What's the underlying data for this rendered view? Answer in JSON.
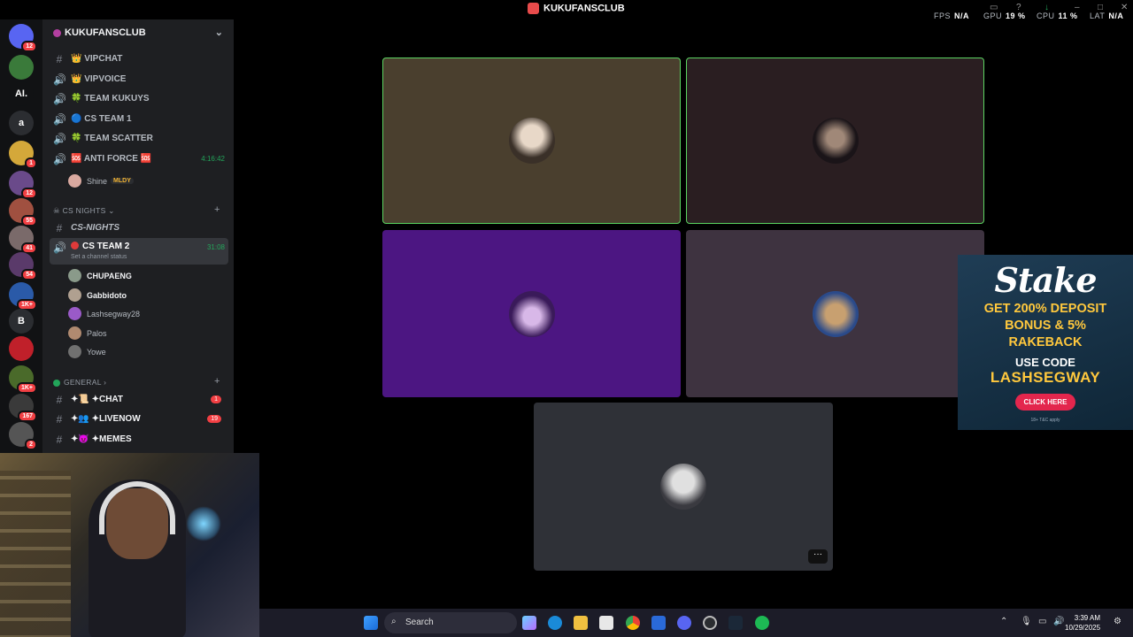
{
  "titlebar": {
    "app_name": "KUKUFANSCLUB",
    "fps_label": "FPS",
    "fps_value": "N/A",
    "gpu_label": "GPU",
    "gpu_value": "19 %",
    "cpu_label": "CPU",
    "cpu_value": "11 %",
    "lat_label": "LAT",
    "lat_value": "N/A"
  },
  "guilds": [
    {
      "label": "",
      "badge": "12",
      "color": "#5865f2"
    },
    {
      "label": "",
      "badge": "",
      "color": "#3a7a3a"
    },
    {
      "label": "AI.",
      "badge": "",
      "color": "#111214"
    },
    {
      "label": "a",
      "badge": "",
      "color": "#2b2d31"
    },
    {
      "label": "",
      "badge": "1",
      "color": "#d4a83a"
    },
    {
      "label": "",
      "badge": "12",
      "color": "#6a4a8a"
    },
    {
      "label": "",
      "badge": "55",
      "color": "#a05040"
    },
    {
      "label": "",
      "badge": "41",
      "color": "#7a6a6a"
    },
    {
      "label": "",
      "badge": "54",
      "color": "#5a3a6a"
    },
    {
      "label": "",
      "badge": "1K+",
      "color": "#2a5aa8"
    },
    {
      "label": "B",
      "badge": "",
      "color": "#2b2d31"
    },
    {
      "label": "",
      "badge": "",
      "color": "#c0202a"
    },
    {
      "label": "",
      "badge": "1K+",
      "color": "#4a6a2a"
    },
    {
      "label": "",
      "badge": "167",
      "color": "#3a3a3a"
    },
    {
      "label": "",
      "badge": "2",
      "color": "#555"
    }
  ],
  "server": {
    "name": "KUKUFANSCLUB",
    "channels_top": [
      {
        "icon": "#",
        "name": "👑 VIPCHAT",
        "timer": ""
      },
      {
        "icon": "🔊",
        "name": "👑 VIPVOICE",
        "timer": ""
      },
      {
        "icon": "🔊",
        "name": "🍀 TEAM KUKUYS",
        "timer": ""
      },
      {
        "icon": "🔊",
        "name": "🔵 CS TEAM 1",
        "timer": ""
      },
      {
        "icon": "🔊",
        "name": "🍀 TEAM SCATTER",
        "timer": ""
      },
      {
        "icon": "🔊",
        "name": "🆘 ANTI FORCE 🆘",
        "timer": "4:16:42"
      }
    ],
    "anti_force_user": {
      "name": "Shine",
      "tag": "MLDY"
    },
    "category_cs": "CS NIGHTS",
    "cs_text_channel": "CS-NIGHTS",
    "active_channel": {
      "name": "CS TEAM 2",
      "timer": "31:08",
      "status": "Set a channel status"
    },
    "voice_users": [
      "CHUPAENG",
      "Gabbidoto",
      "Lashsegway28",
      "Palos",
      "Yowe"
    ],
    "category_general": "GENERAL",
    "general_channels": [
      {
        "name": "✦📜 ✦CHAT",
        "badge": "1"
      },
      {
        "name": "✦👥 ✦LIVENOW",
        "badge": "19"
      },
      {
        "name": "✦😈 ✦MEMES",
        "badge": ""
      }
    ]
  },
  "ad": {
    "brand": "Stake",
    "line1": "GET 200% DEPOSIT",
    "line2": "BONUS & 5%",
    "line3": "RAKEBACK",
    "use_code": "USE CODE",
    "code": "LASHSEGWAY",
    "button": "CLICK HERE",
    "fine": "18+ T&C apply"
  },
  "stage": {
    "more_label": "···"
  },
  "taskbar": {
    "search_label": "Search",
    "time": "3:39 AM",
    "date": "10/29/2025"
  }
}
